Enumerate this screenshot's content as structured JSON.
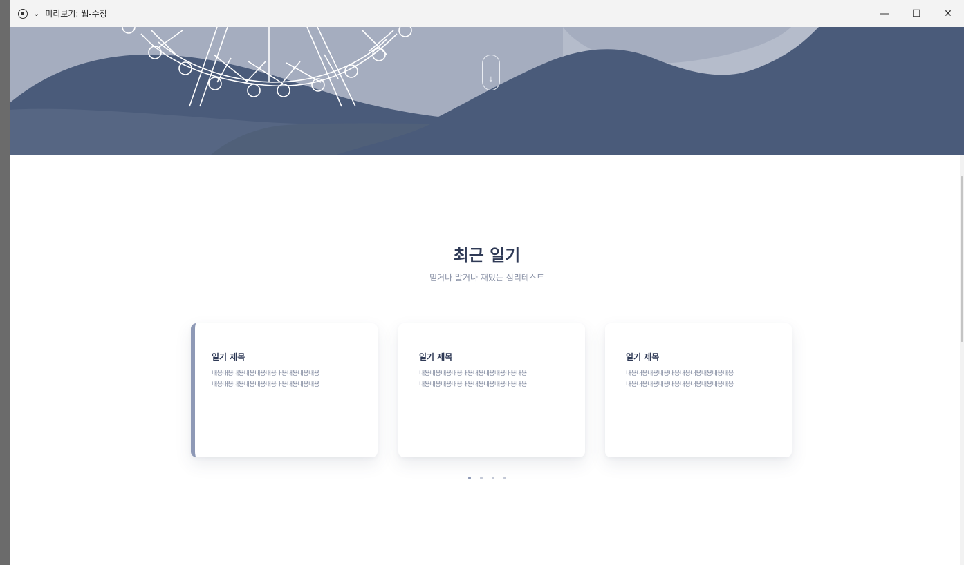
{
  "window": {
    "title": "미리보기: 웹-수정",
    "dropdown_glyph": "⌄",
    "controls": {
      "minimize": "—",
      "maximize": "☐",
      "close": "✕"
    }
  },
  "hero": {
    "scroll_indicator_glyph": "↓",
    "colors": {
      "sky": "#a5adbf",
      "hill_dark": "#4a5b7a",
      "hill_mid": "#566683",
      "ferris_wheel": "#ffffff"
    }
  },
  "section": {
    "title": "최근 일기",
    "subtitle": "믿거나 말거나 재밌는 심리테스트"
  },
  "cards": [
    {
      "title": "일기 제목",
      "line1": "내용내용내용내용내용내용내용내용내용내용",
      "line2": "내용내용내용내용내용내용내용내용내용내용",
      "active": true
    },
    {
      "title": "일기 제목",
      "line1": "내용내용내용내용내용내용내용내용내용내용",
      "line2": "내용내용내용내용내용내용내용내용내용내용",
      "active": false
    },
    {
      "title": "일기 제목",
      "line1": "내용내용내용내용내용내용내용내용내용내용",
      "line2": "내용내용내용내용내용내용내용내용내용내용",
      "active": false
    }
  ],
  "pagination": {
    "count": 4,
    "active_index": 0
  },
  "accent_color": "#8e99b6"
}
